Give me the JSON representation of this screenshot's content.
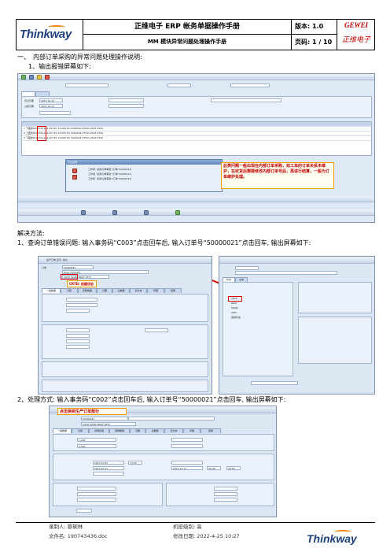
{
  "header": {
    "logo": "Thinkway",
    "title": "正维电子 ERP 帐务单据操作手册",
    "subtitle": "MM 模块异常问题处理操作手册",
    "version": "版本: 1.0",
    "page": "页码: 1 / 10",
    "brand_en": "GEWEI",
    "brand_cn": "正维电子"
  },
  "body": {
    "section": "一、　内部订单采购的异常问题处理操作说明:",
    "step1": "1、输出报错屏幕如下:",
    "solution": "解决方法:",
    "para1": "1、查询订单错误问题: 输入事务码“C003”点击回车后, 输入订单号“50000021”点击回车, 输出屏幕如下:",
    "para2": "2、处理方式: 输入事务码“C002”点击回车后, 输入订单号“50000021”点击回车, 输出屏幕如下:"
  },
  "shot1": {
    "callout": "此类问题一般出现在内部订单采购，如工单的订单关系未维护，在收货后需要修改内部订单号后，再进行结算，一般为订单维护处理。",
    "dialog_title": "正在处理",
    "dialog_lines": [
      "工作项 \"采购订单审批\"(订单 50000041)",
      "工作项 \"采购订单审批\"(订单 50000041)",
      "工作项 \"采购订单审批\"(订单 50000041)"
    ],
    "doc_date_label": "凭证日期",
    "doc_date": "2012.10.24",
    "post_date_label": "过帐日期",
    "post_date": "2012.10.24",
    "rows": [
      "1  下面的PAA170A1A01.E1.E1  10.000  EA  50000041  E001.9505  2500",
      "2  上面的PAA170A1A01.E1.E1  10.000  EA  50000041  E001.9505  2500",
      "3  下面的PAA170A1A01.E1.E1  10.000  EA  50000041  E001.9505  2500"
    ]
  },
  "shot2": {
    "title": "生产订单 显示: 抬头",
    "order_label": "订单",
    "order": "50000041",
    "material": "PAA170A1A01",
    "status": "CRTD MANC BRAT SETC",
    "callout": "CRTD: 创建状态",
    "tabs": [
      "一般数据",
      "分配",
      "控制数据",
      "日期",
      "主数据",
      "长文本",
      "管理",
      "控制"
    ],
    "right_tabs": [
      "状态",
      "文本"
    ],
    "right_items": [
      "CRTD",
      "BRAT",
      "MANC",
      "SETC",
      "其他状态"
    ]
  },
  "shot3": {
    "callout": "点击换到生产订单部分",
    "order": "50000041",
    "status": "CRTD MANC BRAT SETC",
    "tabs": [
      "一般数据",
      "分配",
      "货物接收",
      "控制数据",
      "日期",
      "主数据",
      "长文本",
      "管理",
      "控制"
    ],
    "qty": "1.000",
    "qty2": "0.000",
    "dates": [
      "2012.10.20",
      "2012.10.11",
      "2012.10.11"
    ],
    "times": [
      "24:00",
      "00:00",
      "00:00"
    ]
  },
  "footer": {
    "author": "录制人: 蔡碗林",
    "security": "机密级别: 高",
    "filename": "文件名: 190743436.doc",
    "modified": "修改日期: 2022-4-25 10:27",
    "logo": "Thinkway"
  },
  "colors": {
    "brand": "#c00000",
    "logo": "#1f3f7a",
    "sap_bg": "#dfe9f5"
  }
}
